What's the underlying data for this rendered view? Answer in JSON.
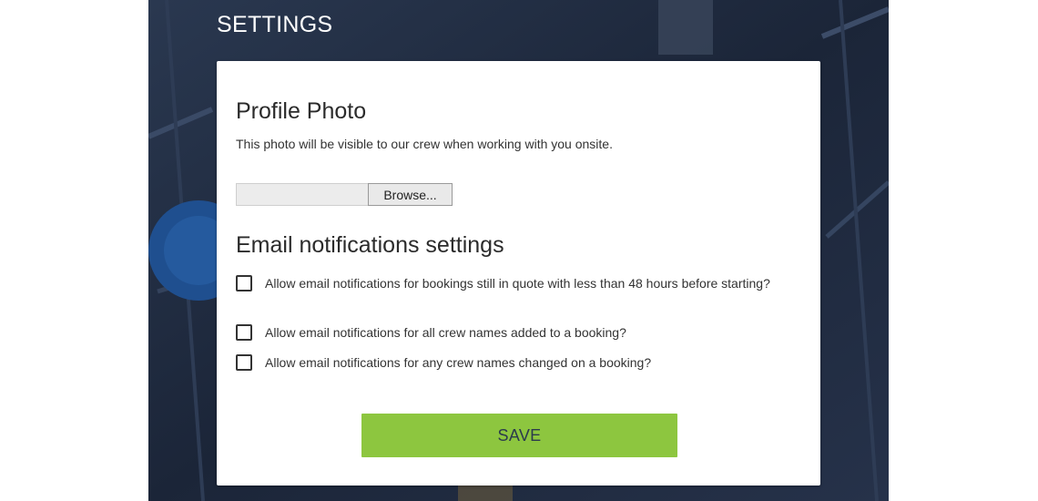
{
  "header": {
    "title": "SETTINGS"
  },
  "profile_photo": {
    "title": "Profile Photo",
    "description": "This photo will be visible to our crew when working with you onsite.",
    "file_value": "",
    "browse_label": "Browse..."
  },
  "email_notifications": {
    "title": "Email notifications settings",
    "options": [
      {
        "label": "Allow email notifications for bookings still in quote with less than 48 hours before starting?",
        "checked": false
      },
      {
        "label": "Allow email notifications for all crew names added to a booking?",
        "checked": false
      },
      {
        "label": "Allow email notifications for any crew names changed on a booking?",
        "checked": false
      }
    ]
  },
  "actions": {
    "save_label": "SAVE"
  },
  "colors": {
    "accent": "#8dc63f",
    "background": "#1f2a3e",
    "card": "#ffffff",
    "text": "#333333"
  }
}
